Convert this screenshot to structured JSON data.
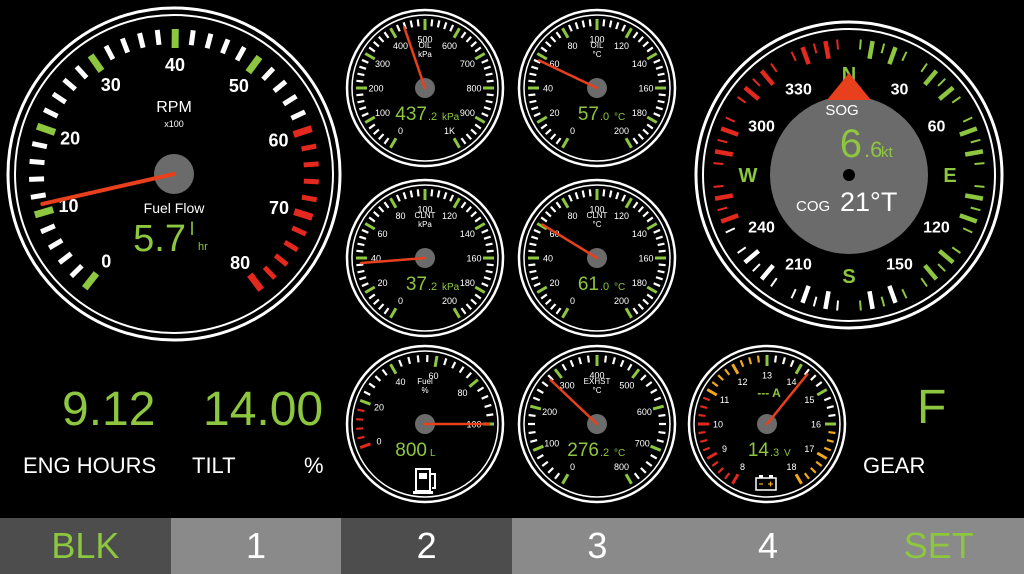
{
  "colors": {
    "accent": "#8dc63f",
    "needle": "#e8401c",
    "warn": "#e3281e",
    "amber": "#f2a81c",
    "tab_dark": "#4d4d4d",
    "tab_light": "#8a8a8a"
  },
  "rpm": {
    "title": "RPM",
    "multiplier": "x100",
    "ticks": [
      "0",
      "10",
      "20",
      "30",
      "40",
      "50",
      "60",
      "70",
      "80"
    ],
    "value": 11,
    "sub_label": "Fuel Flow",
    "sub_value": "5.7",
    "sub_unit_top": "l",
    "sub_unit_bottom": "hr"
  },
  "gauges": {
    "oil_pressure": {
      "label": "OIL",
      "unit": "kPa",
      "ticks": [
        "0",
        "100",
        "200",
        "300",
        "400",
        "500",
        "600",
        "700",
        "800",
        "900",
        "1K"
      ],
      "value": 437,
      "readout_main": "437",
      "readout_frac": ".2",
      "readout_unit": "kPa"
    },
    "oil_temp": {
      "label": "OIL",
      "unit": "°C",
      "ticks": [
        "0",
        "20",
        "40",
        "60",
        "80",
        "100",
        "120",
        "140",
        "160",
        "180",
        "200"
      ],
      "value": 57,
      "readout_main": "57",
      "readout_frac": ".0",
      "readout_unit": "°C"
    },
    "coolant_pressure": {
      "label": "CLNT",
      "unit": "kPa",
      "ticks": [
        "0",
        "20",
        "40",
        "60",
        "80",
        "100",
        "120",
        "140",
        "160",
        "180",
        "200"
      ],
      "value": 37,
      "readout_main": "37",
      "readout_frac": ".2",
      "readout_unit": "kPa"
    },
    "coolant_temp": {
      "label": "CLNT",
      "unit": "°C",
      "ticks": [
        "0",
        "20",
        "40",
        "60",
        "80",
        "100",
        "120",
        "140",
        "160",
        "180",
        "200"
      ],
      "value": 61,
      "readout_main": "61",
      "readout_frac": ".0",
      "readout_unit": "°C"
    },
    "fuel": {
      "label": "Fuel",
      "unit": "%",
      "ticks": [
        "0",
        "20",
        "40",
        "60",
        "80",
        "100"
      ],
      "value": 100,
      "readout_main": "800",
      "readout_unit": "L",
      "icon": "fuel-pump-icon"
    },
    "exhaust": {
      "label": "EXHST",
      "unit": "°C",
      "ticks": [
        "0",
        "100",
        "200",
        "300",
        "400",
        "500",
        "600",
        "700",
        "800"
      ],
      "value": 276,
      "readout_main": "276",
      "readout_frac": ".2",
      "readout_unit": "°C"
    },
    "voltage": {
      "label": "A",
      "amps_value": "---",
      "ticks": [
        "8",
        "9",
        "10",
        "11",
        "12",
        "13",
        "14",
        "15",
        "16",
        "17",
        "18"
      ],
      "value": 14.3,
      "readout_main": "14",
      "readout_frac": ".3",
      "readout_unit": "V",
      "icon": "battery-icon"
    }
  },
  "compass": {
    "labels": [
      "N",
      "30",
      "60",
      "E",
      "120",
      "150",
      "S",
      "210",
      "240",
      "W",
      "300",
      "330"
    ],
    "sog_label": "SOG",
    "sog_main": "6",
    "sog_frac": ".6",
    "sog_unit": "kt",
    "cog_label": "COG",
    "cog_value": "21°T",
    "heading": 0
  },
  "readouts": {
    "eng_hours_value": "9.12",
    "eng_hours_label": "ENG HOURS",
    "tilt_value": "14.00",
    "tilt_label": "TILT",
    "tilt_unit": "%",
    "gear_value": "F",
    "gear_label": "GEAR"
  },
  "tabs": [
    {
      "label": "BLK"
    },
    {
      "label": "1"
    },
    {
      "label": "2"
    },
    {
      "label": "3"
    },
    {
      "label": "4"
    },
    {
      "label": "SET"
    }
  ]
}
